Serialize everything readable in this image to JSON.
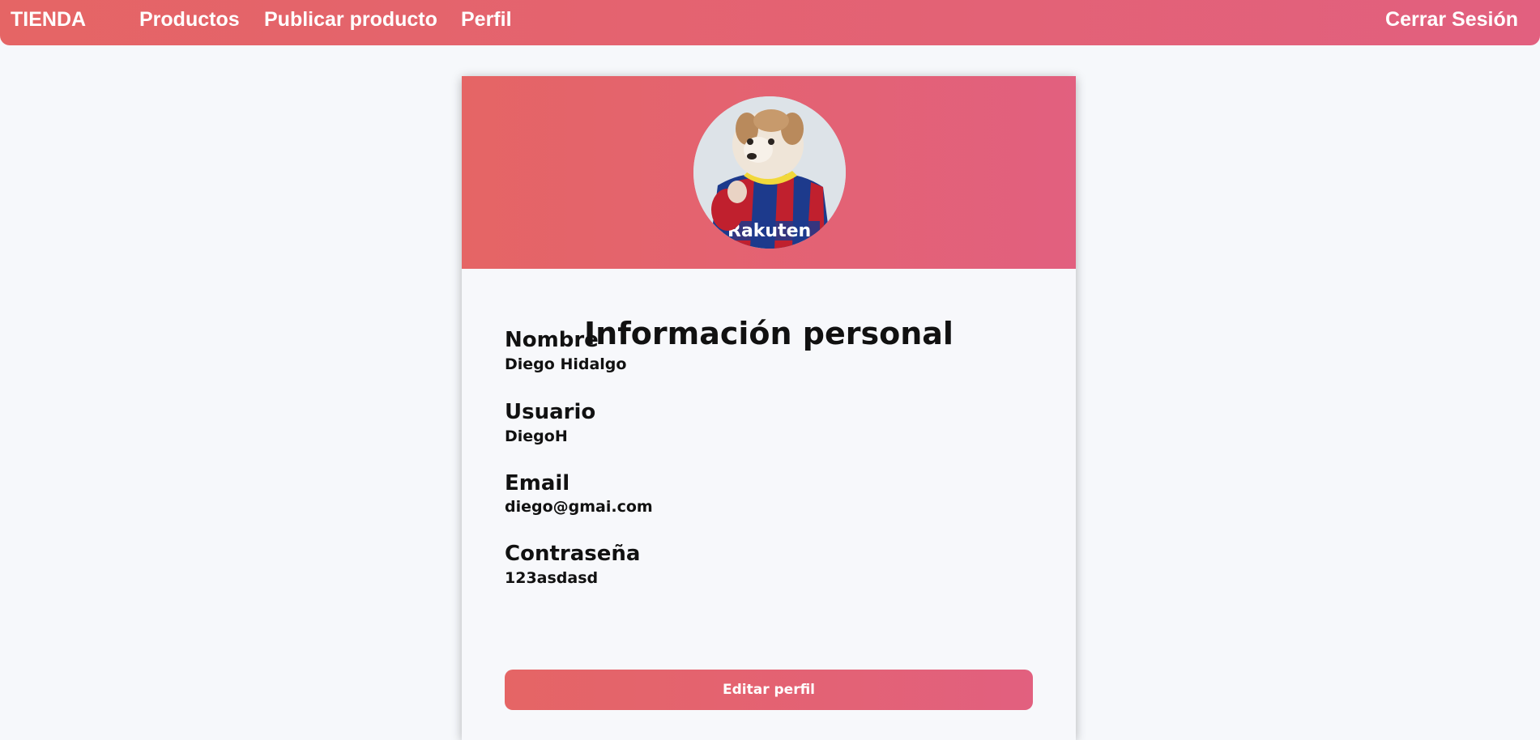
{
  "navbar": {
    "brand": "TIENDA",
    "links": [
      "Productos",
      "Publicar producto",
      "Perfil"
    ],
    "logout": "Cerrar Sesión"
  },
  "profile": {
    "title": "Información personal",
    "avatar_icon": "profile-photo-dog-in-jersey",
    "avatar_text": "Rakuten",
    "fields": [
      {
        "label": "Nombre",
        "value": "Diego Hidalgo"
      },
      {
        "label": "Usuario",
        "value": "DiegoH"
      },
      {
        "label": "Email",
        "value": "diego@gmai.com"
      },
      {
        "label": "Contraseña",
        "value": "123asdasd"
      }
    ],
    "edit_label": "Editar perfil"
  },
  "colors": {
    "accent_start": "#e56565",
    "accent_end": "#e2607f",
    "page_bg": "#f6f8fb"
  }
}
